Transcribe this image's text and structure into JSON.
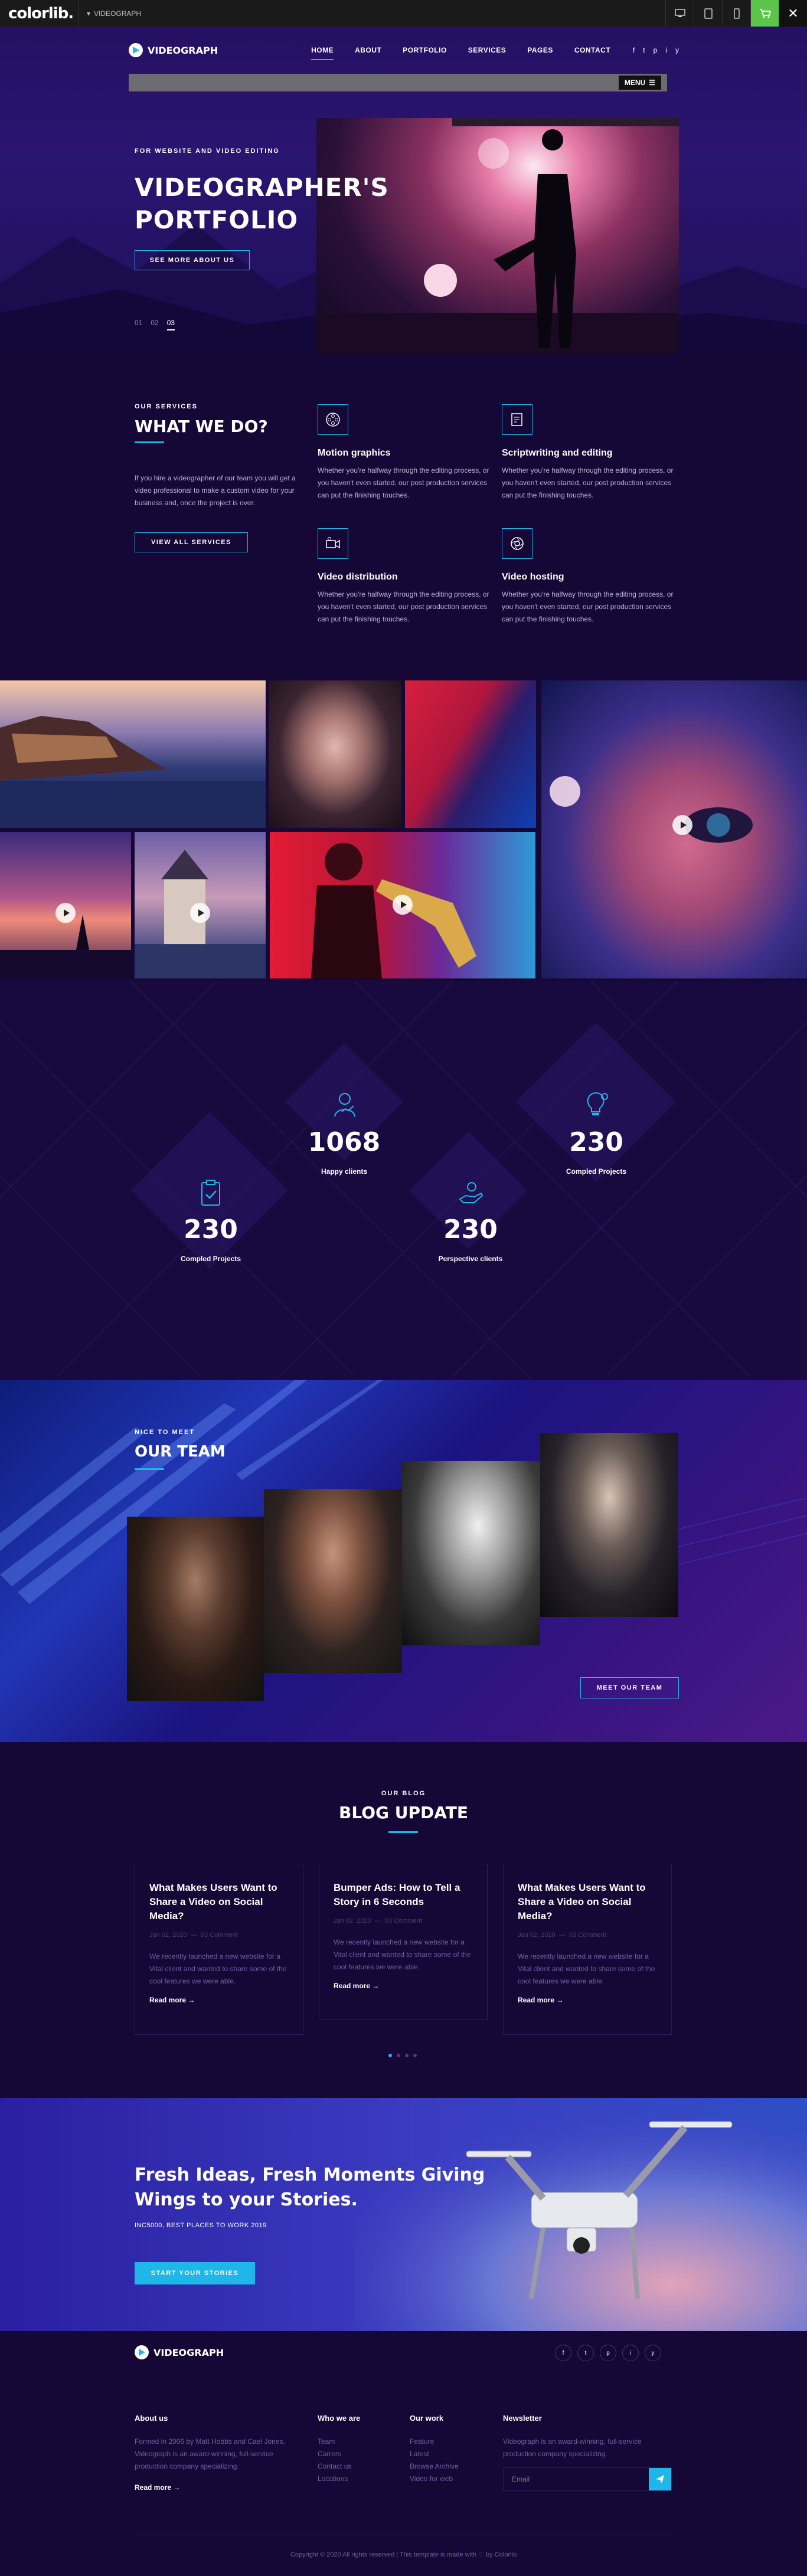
{
  "colorlib_bar": {
    "logo": "colorlib.",
    "template_name": "VIDEOGRAPH",
    "close": "✕"
  },
  "nav": {
    "brand": "VIDEOGRAPH",
    "items": [
      {
        "label": "HOME"
      },
      {
        "label": "ABOUT"
      },
      {
        "label": "PORTFOLIO"
      },
      {
        "label": "SERVICES"
      },
      {
        "label": "PAGES"
      },
      {
        "label": "CONTACT"
      }
    ],
    "social": [
      "f",
      "t",
      "p",
      "i",
      "y"
    ],
    "menu_label": "MENU"
  },
  "hero": {
    "subtitle": "FOR WEBSITE AND VIDEO EDITING",
    "title_line1": "VIDEOGRAPHER'S",
    "title_line2": "PORTFOLIO",
    "button": "SEE MORE ABOUT US",
    "slides": [
      "01",
      "02",
      "03"
    ],
    "active_slide": "03"
  },
  "services": {
    "kicker": "OUR SERVICES",
    "title": "WHAT WE DO?",
    "intro": "If you hire a videographer of our team you will get a video professional to make a custom video for your business and, once the project is over.",
    "button": "VIEW ALL SERVICES",
    "items": [
      {
        "title": "Motion graphics",
        "text": "Whether you're halfway through the editing process, or you haven't even started, our post production services can put the finishing touches.",
        "icon": "film-reel-icon"
      },
      {
        "title": "Scriptwriting and editing",
        "text": "Whether you're halfway through the editing process, or you haven't even started, our post production services can put the finishing touches.",
        "icon": "script-icon"
      },
      {
        "title": "Video distribution",
        "text": "Whether you're halfway through the editing process, or you haven't even started, our post production services can put the finishing touches.",
        "icon": "video-camera-icon"
      },
      {
        "title": "Video hosting",
        "text": "Whether you're halfway through the editing process, or you haven't even started, our post production services can put the finishing touches.",
        "icon": "camera-lens-icon"
      }
    ]
  },
  "counters": [
    {
      "value": "1068",
      "label": "Happy clients",
      "icon": "user-chart-icon"
    },
    {
      "value": "230",
      "label": "Compled Projects",
      "icon": "lightbulb-gear-icon"
    },
    {
      "value": "230",
      "label": "Compled Projects",
      "icon": "clipboard-check-icon"
    },
    {
      "value": "230",
      "label": "Perspective clients",
      "icon": "hand-gear-icon"
    }
  ],
  "team": {
    "kicker": "NICE TO MEET",
    "title": "OUR TEAM",
    "button": "MEET OUR TEAM"
  },
  "blog": {
    "kicker": "OUR BLOG",
    "title": "BLOG UPDATE",
    "posts": [
      {
        "title": "What Makes Users Want to Share a Video on Social Media?",
        "date": "Jan 02, 2020",
        "comments": "03 Comment",
        "excerpt": "We recently launched a new website for a Vital client and wanted to share some of the cool features we were able.",
        "more": "Read more →"
      },
      {
        "title": "Bumper Ads: How to Tell a Story in 6 Seconds",
        "date": "Jan 02, 2020",
        "comments": "03 Comment",
        "excerpt": "We recently launched a new website for a Vital client and wanted to share some of the cool features we were able.",
        "more": "Read more →"
      },
      {
        "title": "What Makes Users Want to Share a Video on Social Media?",
        "date": "Jan 02, 2020",
        "comments": "03 Comment",
        "excerpt": "We recently launched a new website for a Vital client and wanted to share some of the cool features we were able.",
        "more": "Read more →"
      }
    ]
  },
  "cta": {
    "title_line1": "Fresh Ideas, Fresh Moments Giving",
    "title_line2": "Wings to your Stories.",
    "subtitle": "INC5000, BEST PLACES TO WORK 2019",
    "button": "START YOUR STORIES"
  },
  "footer": {
    "brand": "VIDEOGRAPH",
    "about_title": "About us",
    "about_text": "Formed in 2006 by Matt Hobbs and Cael Jones, Videograph is an award-winning, full-service production company specializing.",
    "about_more": "Read more →",
    "col1_title": "Who we are",
    "col1_links": [
      "Team",
      "Carrers",
      "Contact us",
      "Locations"
    ],
    "col2_title": "Our work",
    "col2_links": [
      "Feature",
      "Latest",
      "Browse Archive",
      "Video for web"
    ],
    "news_title": "Newsletter",
    "news_text": "Videograph is an award-winning, full-service production company specializing.",
    "email_placeholder": "Email",
    "social": [
      "f",
      "t",
      "p",
      "i",
      "y"
    ],
    "copyright": "Copyright © 2020 All rights reserved | This template is made with ♡ by Colorlib"
  },
  "colors": {
    "accent": "#1fb6e8",
    "background": "#150736",
    "cart": "#5bc44a"
  }
}
